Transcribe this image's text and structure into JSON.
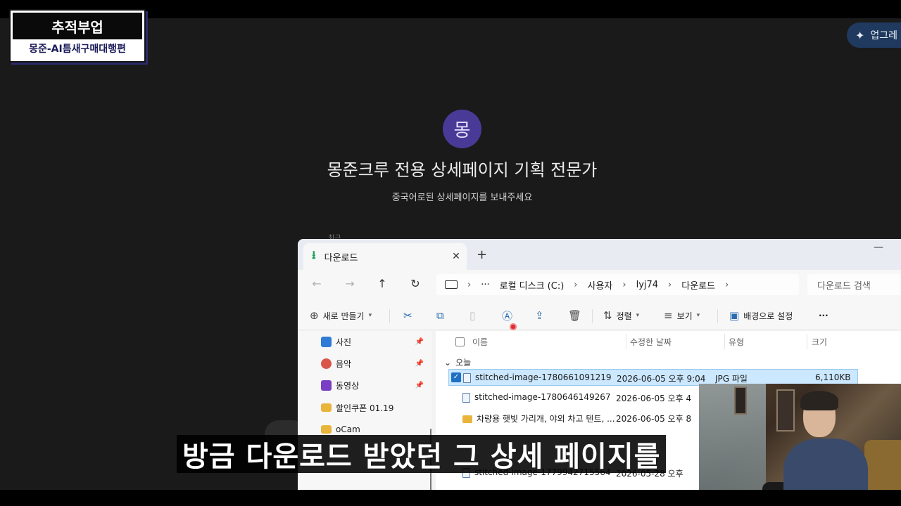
{
  "badge": {
    "title": "추적부업",
    "subtitle": "몽준-AI틈새구매대행편"
  },
  "upgrade": {
    "label": "업그레"
  },
  "gpt": {
    "avatar_letter": "몽",
    "title": "몽준크루 전용 상세페이지 기획 전문가",
    "description": "중국어로된 상세페이지를 보내주세요",
    "recent_label": "최근"
  },
  "explorer": {
    "tab_title": "다운로드",
    "tab_close": "✕",
    "new_tab": "+",
    "minimize": "—",
    "nav": {
      "back": "←",
      "forward": "→",
      "up": "↑",
      "refresh": "↻"
    },
    "address": {
      "more": "···",
      "segments": [
        "로컬 디스크 (C:)",
        "사용자",
        "lyj74",
        "다운로드"
      ],
      "separator": "›"
    },
    "search_placeholder": "다운로드 검색",
    "toolbar": {
      "new_label": "새로 만들기",
      "sort_label": "정렬",
      "view_label": "보기",
      "wallpaper_label": "배경으로 설정",
      "more": "···"
    },
    "sidebar": [
      {
        "label": "사진",
        "icon": "photos-icon",
        "color": "#2f7bd6",
        "pinned": true
      },
      {
        "label": "음악",
        "icon": "music-icon",
        "color": "#d9564a",
        "pinned": true
      },
      {
        "label": "동영상",
        "icon": "video-icon",
        "color": "#7b3fc4",
        "pinned": true
      },
      {
        "label": "할인쿠폰 01.19",
        "icon": "folder-icon",
        "color": "#e8b43a",
        "pinned": false
      },
      {
        "label": "oCam",
        "icon": "folder-icon",
        "color": "#e8b43a",
        "pinned": false
      }
    ],
    "columns": {
      "name": "이름",
      "modified": "수정한 날짜",
      "type": "유형",
      "size": "크기"
    },
    "group_label": "오늘",
    "files": [
      {
        "name": "stitched-image-1780661091219",
        "modified": "2026-06-05 오후 9:04",
        "type": "JPG 파일",
        "size": "6,110KB",
        "kind": "file",
        "selected": true
      },
      {
        "name": "stitched-image-1780646149267",
        "modified": "2026-06-05 오후 4",
        "type": "",
        "size": "",
        "kind": "file",
        "selected": false
      },
      {
        "name": "차량용 햇빛 가리개, 야외 차고 텐트, ...",
        "modified": "2026-06-05 오후 8",
        "type": "",
        "size": "",
        "kind": "folder",
        "selected": false
      },
      {
        "name": "stitched-image-1779942715564",
        "modified": "2026-05-28 오후",
        "type": "",
        "size": "",
        "kind": "file",
        "selected": false
      }
    ]
  },
  "subtitle": "방금 다운로드 받았던 그 상세 페이지를",
  "colors": {
    "accent": "#1f6fc2",
    "avatar": "#4a3a98",
    "selection": "#cce8ff",
    "upgrade_bg": "#1f3a5e"
  }
}
